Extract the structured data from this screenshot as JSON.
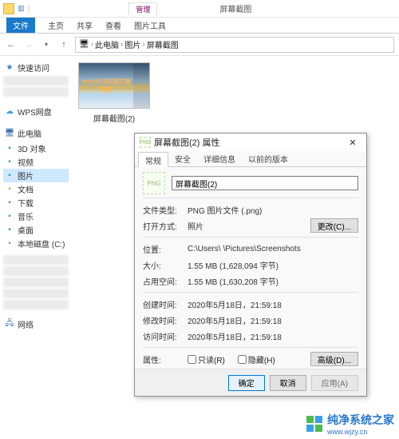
{
  "titlebar": {
    "context_tab": "管理",
    "window_title": "屏幕截图"
  },
  "ribbon": {
    "file": "文件",
    "tabs": [
      "主页",
      "共享",
      "查看",
      "图片工具"
    ]
  },
  "breadcrumb": {
    "parts": [
      "此电脑",
      "图片",
      "屏幕截图"
    ]
  },
  "sidebar": {
    "quick": "快速访问",
    "wps": "WPS网盘",
    "thispc": "此电脑",
    "items": [
      {
        "label": "3D 对象",
        "color": "#2aa5c4"
      },
      {
        "label": "视频",
        "color": "#2aa5c4"
      },
      {
        "label": "图片",
        "color": "#2aa5c4",
        "selected": true
      },
      {
        "label": "文档",
        "color": "#cfae52"
      },
      {
        "label": "下载",
        "color": "#57a957"
      },
      {
        "label": "音乐",
        "color": "#2aa5c4"
      },
      {
        "label": "桌面",
        "color": "#2aa5c4"
      },
      {
        "label": "本地磁盘 (C:)",
        "color": "#9aa0a6"
      }
    ],
    "network": "网络"
  },
  "content": {
    "thumb_banner": "win10白动切换主题背景",
    "thumb_label": "屏幕截图(2)"
  },
  "dialog": {
    "title": "屏幕截图(2) 属性",
    "close": "✕",
    "tabs": [
      "常规",
      "安全",
      "详细信息",
      "以前的版本"
    ],
    "filename": "屏幕截图(2)",
    "rows": {
      "type_lbl": "文件类型:",
      "type_val": "PNG 图片文件 (.png)",
      "open_lbl": "打开方式:",
      "open_val": "照片",
      "change_btn": "更改(C)...",
      "loc_lbl": "位置:",
      "loc_val": "C:\\Users\\       \\Pictures\\Screenshots",
      "size_lbl": "大小:",
      "size_val": "1.55 MB (1,628,094 字节)",
      "disk_lbl": "占用空间:",
      "disk_val": "1.55 MB (1,630,208 字节)",
      "created_lbl": "创建时间:",
      "created_val": "2020年5月18日，21:59:18",
      "modified_lbl": "修改时间:",
      "modified_val": "2020年5月18日，21:59:18",
      "accessed_lbl": "访问时间:",
      "accessed_val": "2020年5月18日，21:59:18",
      "attr_lbl": "属性:",
      "readonly": "只读(R)",
      "hidden": "隐藏(H)",
      "advanced_btn": "高级(D)..."
    },
    "footer": {
      "ok": "确定",
      "cancel": "取消",
      "apply": "应用(A)"
    }
  },
  "watermark": {
    "brand": "纯净系统之家",
    "url": "www.wjzy.cn"
  }
}
